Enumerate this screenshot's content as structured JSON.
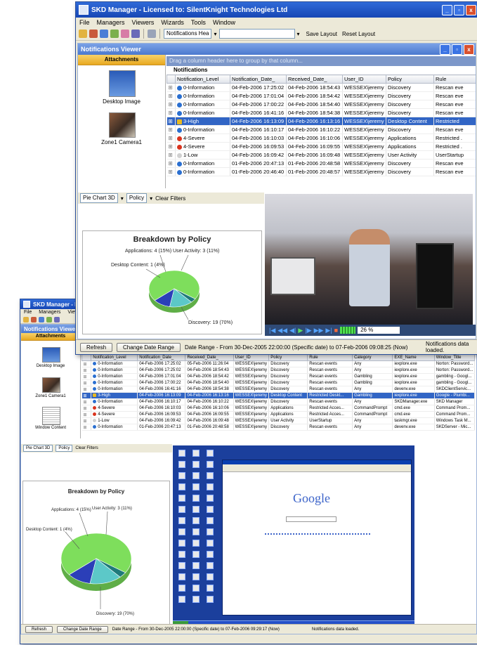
{
  "front_window": {
    "title": "SKD Manager - Licensed to: SilentKnight Technologies Ltd",
    "menu": [
      "File",
      "Managers",
      "Viewers",
      "Wizards",
      "Tools",
      "Window"
    ],
    "toolbar": {
      "notifications_combo": "Notifications Hea",
      "save_layout": "Save Layout",
      "reset_layout": "Reset Layout"
    },
    "viewer_title": "Notifications Viewer",
    "attachments_label": "Attachments",
    "attachments": [
      "Desktop Image",
      "Zone1 Camera1"
    ],
    "group_hint": "Drag a column header here to group by that column...",
    "grid_title": "Notifications",
    "columns": [
      "Notification_Level",
      "Notification_Date_",
      "Received_Date_",
      "User_ID",
      "Policy",
      "Rule"
    ],
    "rows": [
      {
        "level": "0-Information",
        "icon": "info",
        "date": "04-Feb-2006 17:25:02",
        "received": "04-Feb-2006 18:54:43",
        "user": "WESSEX\\jeremy",
        "policy": "Discovery",
        "rule": "Rescan eve"
      },
      {
        "level": "0-Information",
        "icon": "info",
        "date": "04-Feb-2006 17:01:04",
        "received": "04-Feb-2006 18:54:42",
        "user": "WESSEX\\jeremy",
        "policy": "Discovery",
        "rule": "Rescan eve"
      },
      {
        "level": "0-Information",
        "icon": "info",
        "date": "04-Feb-2006 17:00:22",
        "received": "04-Feb-2006 18:54:40",
        "user": "WESSEX\\jeremy",
        "policy": "Discovery",
        "rule": "Rescan eve"
      },
      {
        "level": "0-Information",
        "icon": "info",
        "date": "04-Feb-2006 16:41:16",
        "received": "04-Feb-2006 18:54:38",
        "user": "WESSEX\\jeremy",
        "policy": "Discovery",
        "rule": "Rescan eve"
      },
      {
        "level": "3-High",
        "icon": "high",
        "date": "04-Feb-2006 16:13:09",
        "received": "04-Feb-2006 16:13:16",
        "user": "WESSEX\\jeremy",
        "policy": "Desktop Content",
        "rule": "Restricted",
        "selected": true
      },
      {
        "level": "0-Information",
        "icon": "info",
        "date": "04-Feb-2006 16:10:17",
        "received": "04-Feb-2006 16:10:22",
        "user": "WESSEX\\jeremy",
        "policy": "Discovery",
        "rule": "Rescan eve"
      },
      {
        "level": "4-Severe",
        "icon": "severe",
        "date": "04-Feb-2006 16:10:03",
        "received": "04-Feb-2006 16:10:06",
        "user": "WESSEX\\jeremy",
        "policy": "Applications",
        "rule": "Restricted ."
      },
      {
        "level": "4-Severe",
        "icon": "severe",
        "date": "04-Feb-2006 16:09:53",
        "received": "04-Feb-2006 16:09:55",
        "user": "WESSEX\\jeremy",
        "policy": "Applications",
        "rule": "Restricted ."
      },
      {
        "level": "1-Low",
        "icon": "low",
        "date": "04-Feb-2006 16:09:42",
        "received": "04-Feb-2006 16:09:48",
        "user": "WESSEX\\jeremy",
        "policy": "User Activity",
        "rule": "UserStartup"
      },
      {
        "level": "0-Information",
        "icon": "info",
        "date": "01-Feb-2006 20:47:13",
        "received": "01-Feb-2006 20:48:58",
        "user": "WESSEX\\jeremy",
        "policy": "Discovery",
        "rule": "Rescan eve"
      },
      {
        "level": "0-Information",
        "icon": "info",
        "date": "01-Feb-2006 20:46:40",
        "received": "01-Feb-2006 20:48:57",
        "user": "WESSEX\\jeremy",
        "policy": "Discovery",
        "rule": "Rescan eve"
      }
    ],
    "chart_controls": {
      "chart_type": "Pie Chart 3D",
      "group_field": "Policy",
      "clear_filters": "Clear Filters"
    },
    "video": {
      "zoom": "26 %"
    },
    "status": {
      "refresh": "Refresh",
      "change_date_range": "Change Date Range",
      "range_text": "Date Range - From 30-Dec-2005 22:00:00 (Specific date) to 07-Feb-2006 09:08:25 (Now)",
      "loaded": "Notifications data loaded."
    }
  },
  "back_window": {
    "title": "SKD Manager - Licensed",
    "menu": [
      "File",
      "Managers",
      "Viewers",
      "Wi"
    ],
    "viewer_title": "Notifications Viewer",
    "attachments_label": "Attachments",
    "attachments": [
      "Desktop Image",
      "Zone1 Camera1",
      "Window Content"
    ],
    "columns": [
      "Notification_Level",
      "Notification_Date_",
      "Received_Date_",
      "User_ID",
      "Policy",
      "Rule",
      "Category",
      "EXE_Name",
      "Window_Title"
    ],
    "rows": [
      {
        "level": "0-Information",
        "icon": "info",
        "date": "04-Feb-2006 17:25:02",
        "received": "05-Feb-2006 11:26:04",
        "user": "WESSEX\\jeremy",
        "policy": "Discovery",
        "rule": "Rescan events",
        "category": "Any",
        "exe": "iexplore.exe",
        "title": "Norton: Password..."
      },
      {
        "level": "0-Information",
        "icon": "info",
        "date": "04-Feb-2006 17:25:02",
        "received": "04-Feb-2006 18:54:43",
        "user": "WESSEX\\jeremy",
        "policy": "Discovery",
        "rule": "Rescan events",
        "category": "Any",
        "exe": "iexplore.exe",
        "title": "Norton: Password..."
      },
      {
        "level": "0-Information",
        "icon": "info",
        "date": "04-Feb-2006 17:01:04",
        "received": "04-Feb-2006 18:54:42",
        "user": "WESSEX\\jeremy",
        "policy": "Discovery",
        "rule": "Rescan events",
        "category": "Gambling",
        "exe": "iexplore.exe",
        "title": "gambling - Googl..."
      },
      {
        "level": "0-Information",
        "icon": "info",
        "date": "04-Feb-2006 17:00:22",
        "received": "04-Feb-2006 18:54:40",
        "user": "WESSEX\\jeremy",
        "policy": "Discovery",
        "rule": "Rescan events",
        "category": "Gambling",
        "exe": "iexplore.exe",
        "title": "gambling - Googl..."
      },
      {
        "level": "0-Information",
        "icon": "info",
        "date": "04-Feb-2006 16:41:16",
        "received": "04-Feb-2006 18:54:38",
        "user": "WESSEX\\jeremy",
        "policy": "Discovery",
        "rule": "Rescan events",
        "category": "Any",
        "exe": "devenv.exe",
        "title": "SKDClientServic..."
      },
      {
        "level": "3-High",
        "icon": "high",
        "date": "04-Feb-2006 16:13:09",
        "received": "04-Feb-2006 16:13:16",
        "user": "WESSEX\\jeremy",
        "policy": "Desktop Content",
        "rule": "Restricted Deskt...",
        "category": "Gambling",
        "exe": "iexplore.exe",
        "title": "Google - Plumbi...",
        "selected": true
      },
      {
        "level": "0-Information",
        "icon": "info",
        "date": "04-Feb-2006 16:10:17",
        "received": "04-Feb-2006 16:10:22",
        "user": "WESSEX\\jeremy",
        "policy": "Discovery",
        "rule": "Rescan events",
        "category": "Any",
        "exe": "SKDManager.exe",
        "title": "SKD Manager"
      },
      {
        "level": "4-Severe",
        "icon": "severe",
        "date": "04-Feb-2006 16:10:03",
        "received": "04-Feb-2006 16:10:06",
        "user": "WESSEX\\jeremy",
        "policy": "Applications",
        "rule": "Restricted Acces...",
        "category": "CommandPrompt",
        "exe": "cmd.exe",
        "title": "Command Prom..."
      },
      {
        "level": "4-Severe",
        "icon": "severe",
        "date": "04-Feb-2006 16:09:53",
        "received": "04-Feb-2006 16:09:55",
        "user": "WESSEX\\jeremy",
        "policy": "Applications",
        "rule": "Restricted Acces...",
        "category": "CommandPrompt",
        "exe": "cmd.exe",
        "title": "Command Prom..."
      },
      {
        "level": "1-Low",
        "icon": "low",
        "date": "04-Feb-2006 16:09:42",
        "received": "04-Feb-2006 16:09:48",
        "user": "WESSEX\\jeremy",
        "policy": "User Activity",
        "rule": "UserStartup",
        "category": "Any",
        "exe": "taskmgr.exe",
        "title": "Windows Task M..."
      },
      {
        "level": "0-Information",
        "icon": "info",
        "date": "01-Feb-2006 20:47:13",
        "received": "01-Feb-2006 20:48:58",
        "user": "WESSEX\\jeremy",
        "policy": "Discovery",
        "rule": "Rescan events",
        "category": "Any",
        "exe": "devenv.exe",
        "title": "SKDServer - Mic..."
      }
    ],
    "chart_controls": {
      "chart_type": "Pie Chart 3D",
      "group_field": "Policy",
      "clear_filters": "Clear Filters"
    },
    "screen": {
      "logo": "Google"
    },
    "status": {
      "refresh": "Refresh",
      "change_date_range": "Change Date Range",
      "range_text": "Date Range - From 30-Dec-2005 22:00:00 (Specific date) to 07-Feb-2006 09:29:17 (Now)",
      "loaded": "Notifications data loaded."
    }
  },
  "chart_data": [
    {
      "type": "pie",
      "title": "Breakdown by Policy",
      "slices": [
        {
          "label": "Discovery: 19 (70%)",
          "value": 19,
          "color": "#7ede5c"
        },
        {
          "label": "Desktop Content: 1 (4%)",
          "value": 1,
          "color": "#1f7a7a"
        },
        {
          "label": "Applications: 4 (15%)",
          "value": 4,
          "color": "#5cc8c8"
        },
        {
          "label": "User Activity: 3 (11%)",
          "value": 3,
          "color": "#2b3fb8"
        }
      ]
    },
    {
      "type": "pie",
      "title": "Breakdown by Policy",
      "slices": [
        {
          "label": "Discovery: 19 (70%)",
          "value": 19,
          "color": "#7ede5c"
        },
        {
          "label": "Desktop Content: 1 (4%)",
          "value": 1,
          "color": "#1f7a7a"
        },
        {
          "label": "Applications: 4 (15%)",
          "value": 4,
          "color": "#5cc8c8"
        },
        {
          "label": "User Activity: 3 (11%)",
          "value": 3,
          "color": "#2b3fb8"
        }
      ]
    }
  ]
}
